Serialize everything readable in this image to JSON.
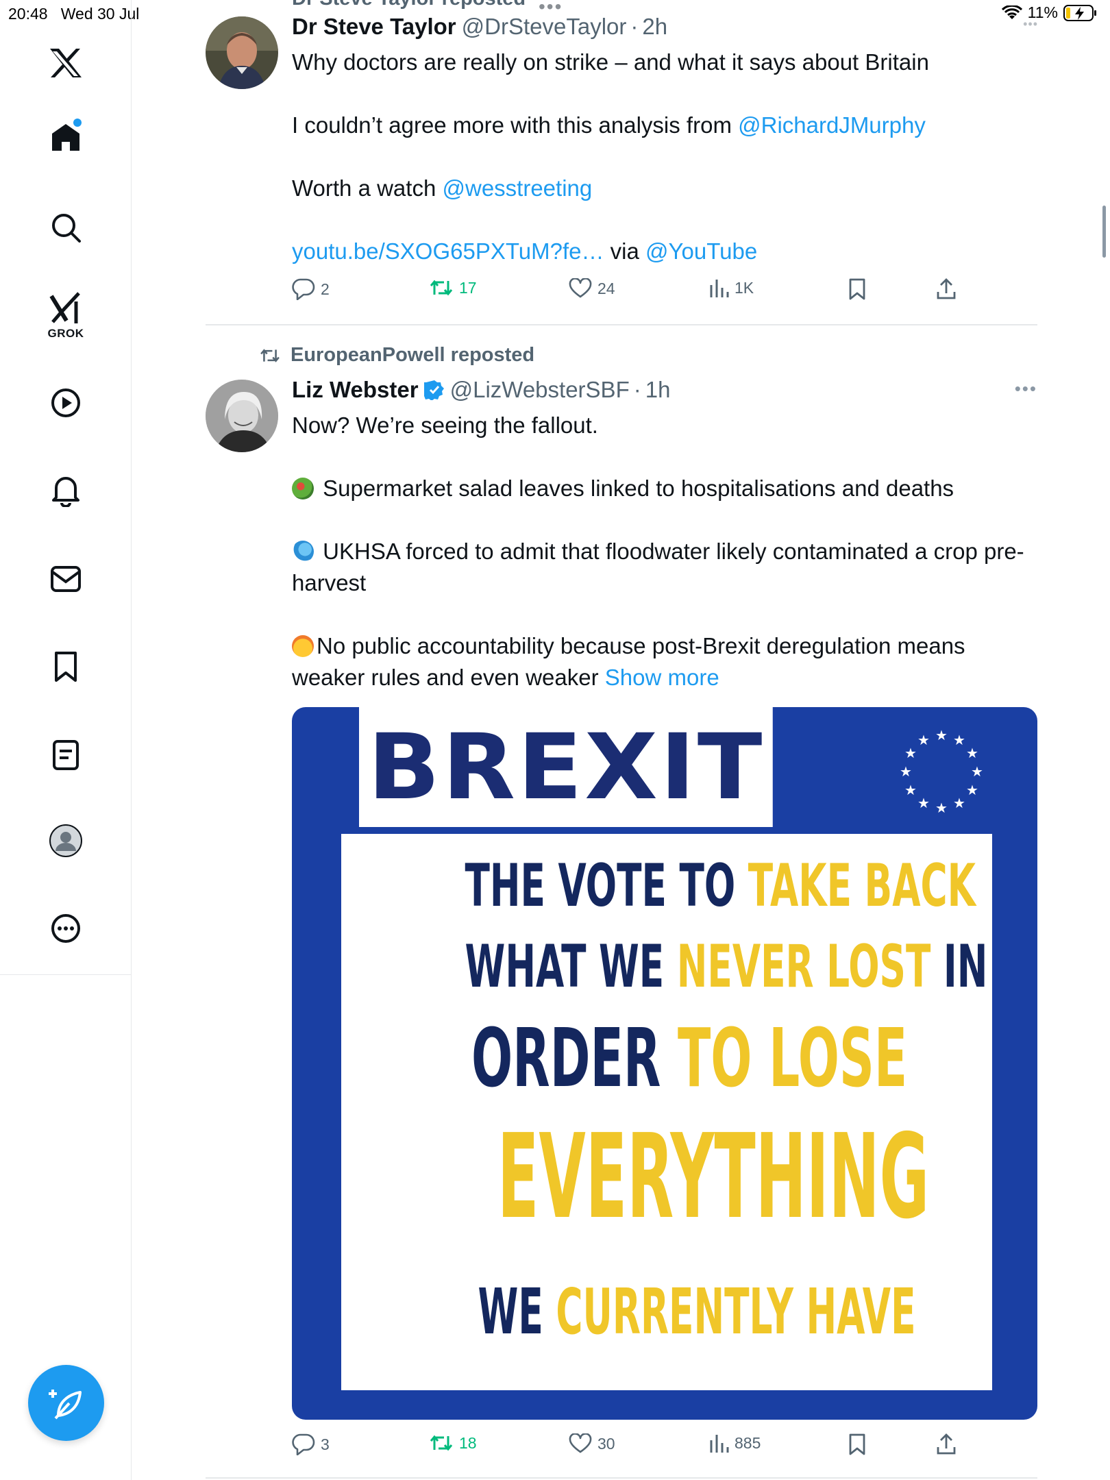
{
  "status_bar": {
    "time": "20:48",
    "date": "Wed 30 Jul",
    "battery": "11%"
  },
  "sidebar": {
    "items": [
      {
        "name": "x-logo"
      },
      {
        "name": "home"
      },
      {
        "name": "search"
      },
      {
        "name": "grok",
        "label": "GROK"
      },
      {
        "name": "video"
      },
      {
        "name": "notifications"
      },
      {
        "name": "messages"
      },
      {
        "name": "bookmarks"
      },
      {
        "name": "lists"
      },
      {
        "name": "profile"
      },
      {
        "name": "more"
      }
    ],
    "compose_icon": "compose-icon"
  },
  "tweet1": {
    "partial_repost_header": "Dr Steve Taylor reposted",
    "name": "Dr Steve Taylor",
    "handle": "@DrSteveTaylor",
    "separator": "·",
    "time": "2h",
    "line1": "Why doctors are really on strike – and what it says about Britain",
    "line2_text": "I couldn’t agree more with this analysis from ",
    "line2_link": "@RichardJMurphy",
    "line3_text": "Worth a watch ",
    "line3_link": "@wesstreeting",
    "line4_link": "youtu.be/SXOG65PXTuM?fe…",
    "line4_text": " via ",
    "line4_link2": "@YouTube",
    "replies": "2",
    "reposts": "17",
    "likes": "24",
    "views": "1K"
  },
  "tweet2": {
    "reposted_by": "EuropeanPowell reposted",
    "name": "Liz Webster",
    "verified": true,
    "handle": "@LizWebsterSBF",
    "separator": "·",
    "time": "1h",
    "para1": "Now? We’re seeing the fallout.",
    "para2": "Supermarket salad leaves linked to hospitalisations and deaths",
    "para3": "UKHSA forced to admit that floodwater likely contaminated a crop pre-harvest",
    "para4": "No public accountability because post-Brexit deregulation means weaker rules and even weaker",
    "show_more": "Show more",
    "replies": "3",
    "reposts": "18",
    "likes": "30",
    "views": "885",
    "image": {
      "title": "BREXIT",
      "line1_a": "THE VOTE TO ",
      "line1_b": "TAKE BACK",
      "line2_a": "WHAT WE ",
      "line2_b": "NEVER LOST",
      "line2_c": " IN",
      "line3_a": "ORDER ",
      "line3_b": "TO LOSE",
      "line4": "EVERYTHING",
      "line5_a": "WE ",
      "line5_b": "CURRENTLY HAVE"
    }
  },
  "colors": {
    "accent": "#1d9bf0",
    "repost_green": "#00ba7c",
    "muted": "#536471",
    "eu_blue": "#1a3fa3",
    "eu_yellow": "#f0c629"
  }
}
